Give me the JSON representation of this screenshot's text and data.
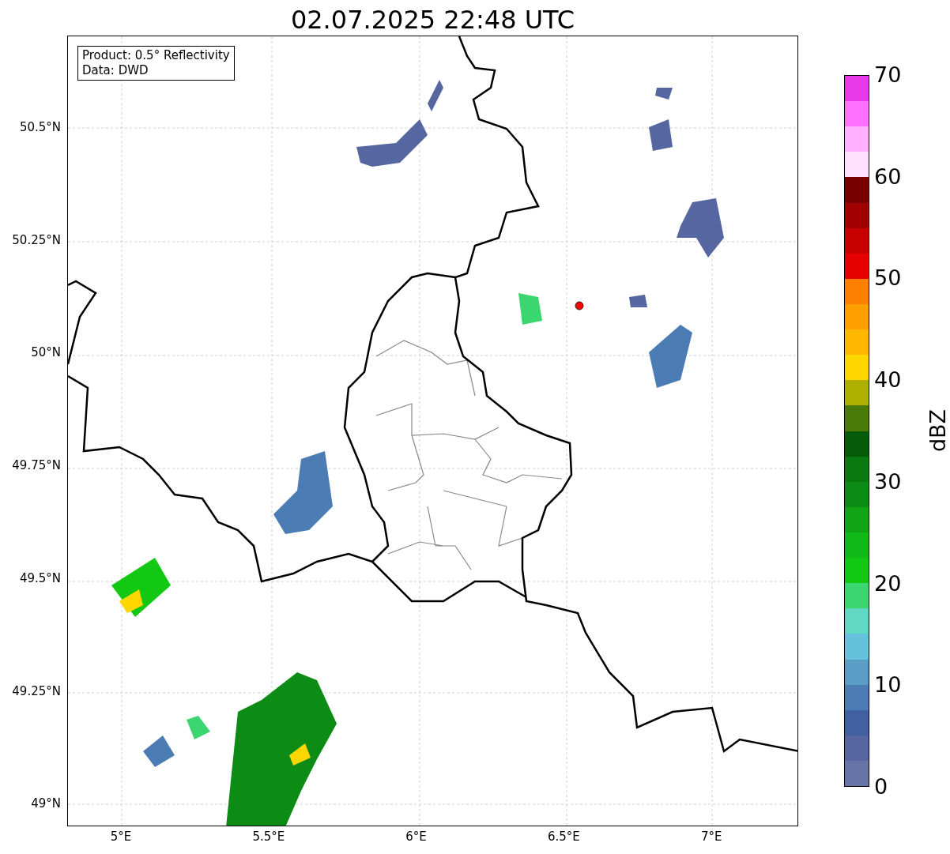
{
  "title": "02.07.2025 22:48 UTC",
  "info_box": {
    "lines": [
      "Product: 0.5° Reflectivity",
      "Data: DWD"
    ]
  },
  "y_ticks": [
    "50.5°N",
    "50.25°N",
    "50°N",
    "49.75°N",
    "49.5°N",
    "49.25°N",
    "49°N"
  ],
  "x_ticks": [
    "5°E",
    "5.5°E",
    "6°E",
    "6.5°E",
    "7°E"
  ],
  "colorbar": {
    "label": "dBZ",
    "ticks": [
      "70",
      "60",
      "50",
      "40",
      "30",
      "20",
      "10",
      "0"
    ],
    "segments": [
      {
        "color": "#e838e8"
      },
      {
        "color": "#ff70ff"
      },
      {
        "color": "#ffb0ff"
      },
      {
        "color": "#ffe0ff"
      },
      {
        "color": "#780000"
      },
      {
        "color": "#a00000"
      },
      {
        "color": "#c80000"
      },
      {
        "color": "#e60000"
      },
      {
        "color": "#ff7f00"
      },
      {
        "color": "#ff9f00"
      },
      {
        "color": "#ffb700"
      },
      {
        "color": "#ffd700"
      },
      {
        "color": "#b0b000"
      },
      {
        "color": "#4a7a0a"
      },
      {
        "color": "#075c0a"
      },
      {
        "color": "#0a7a10"
      },
      {
        "color": "#0c8c14"
      },
      {
        "color": "#10a414"
      },
      {
        "color": "#10b818"
      },
      {
        "color": "#12c812"
      },
      {
        "color": "#3cd670"
      },
      {
        "color": "#60d8c4"
      },
      {
        "color": "#66c2dc"
      },
      {
        "color": "#5a9ec8"
      },
      {
        "color": "#4c7cb4"
      },
      {
        "color": "#4160a0"
      },
      {
        "color": "#5566a0"
      },
      {
        "color": "#6674a8"
      }
    ]
  }
}
